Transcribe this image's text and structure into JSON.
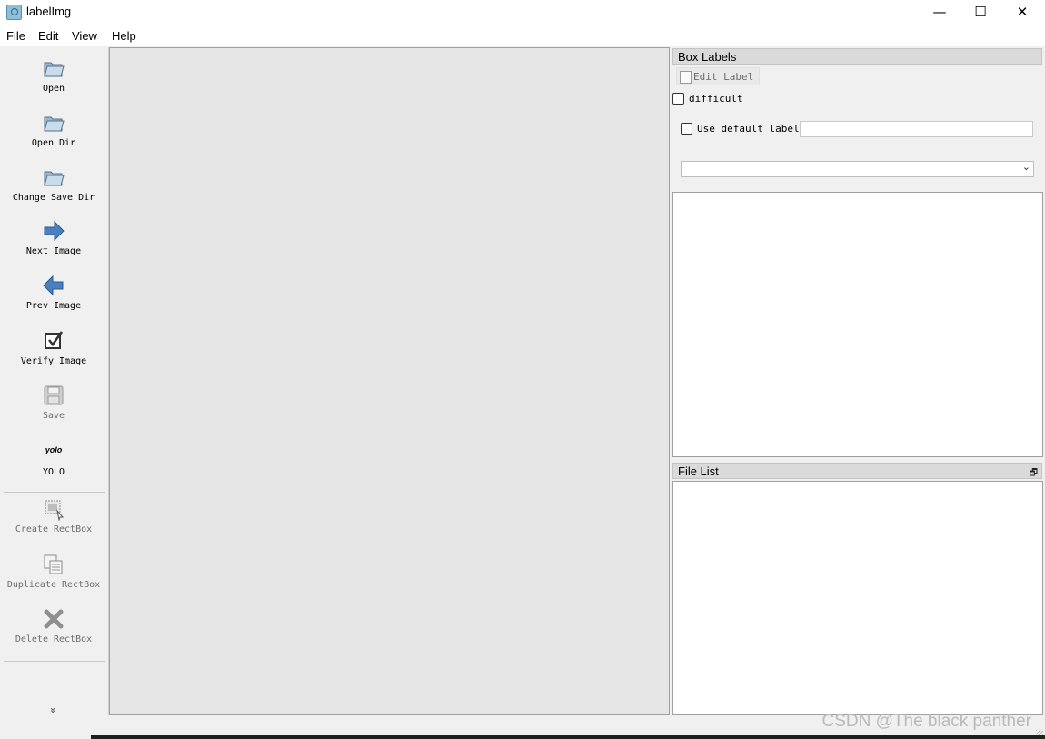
{
  "window": {
    "title": "labelImg",
    "minimize": "—",
    "maximize": "☐",
    "close": "✕"
  },
  "menu": [
    "File",
    "Edit",
    "View",
    "Help"
  ],
  "toolbar": {
    "items": [
      {
        "label": "Open",
        "icon": "folder-open-icon"
      },
      {
        "label": "Open Dir",
        "icon": "folder-open-icon"
      },
      {
        "label": "Change Save Dir",
        "icon": "folder-open-icon"
      },
      {
        "label": "Next Image",
        "icon": "arrow-right-icon"
      },
      {
        "label": "Prev Image",
        "icon": "arrow-left-icon"
      },
      {
        "label": "Verify Image",
        "icon": "checkbox-icon"
      },
      {
        "label": "Save",
        "icon": "floppy-disk-icon"
      },
      {
        "label": "YOLO",
        "icon_text": "yolo"
      },
      {
        "label": "Create RectBox",
        "icon": "create-rect-icon"
      },
      {
        "label": "Duplicate RectBox",
        "icon": "duplicate-icon"
      },
      {
        "label": "Delete RectBox",
        "icon": "delete-cross-icon"
      }
    ],
    "more": "»"
  },
  "box_labels": {
    "header": "Box Labels",
    "edit_label": "Edit Label",
    "difficult": "difficult",
    "use_default_label": "Use default label",
    "default_label_value": "",
    "combo_value": ""
  },
  "file_list": {
    "header": "File List",
    "float_icon": "🗗"
  },
  "watermark": "CSDN @The black panther"
}
